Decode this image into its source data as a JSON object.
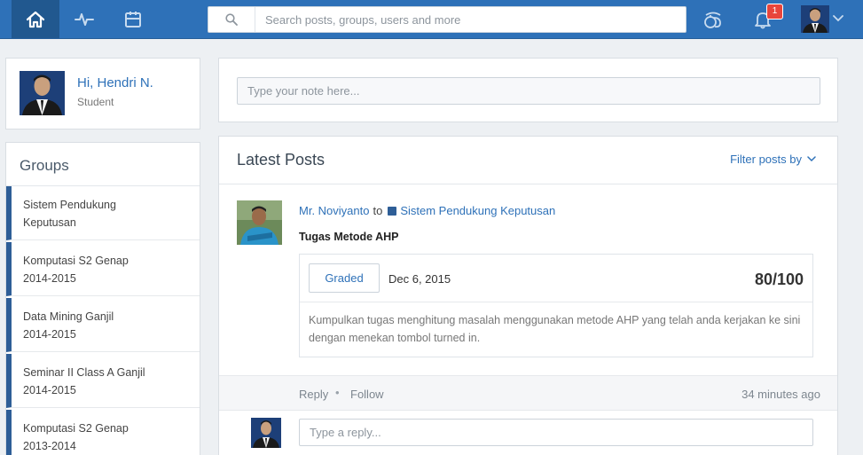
{
  "topbar": {
    "search_placeholder": "Search posts, groups, users and more",
    "notification_count": "1",
    "colors": {
      "bar": "#2e71b8",
      "active": "#21588f",
      "badge": "#e8453c"
    }
  },
  "profile": {
    "greeting": "Hi, Hendri N.",
    "role": "Student"
  },
  "groups": {
    "title": "Groups",
    "items": [
      {
        "name": "Sistem Pendukung",
        "subtitle": "Keputusan"
      },
      {
        "name": "Komputasi S2 Genap",
        "subtitle": "2014-2015"
      },
      {
        "name": "Data Mining Ganjil",
        "subtitle": "2014-2015"
      },
      {
        "name": "Seminar II Class A Ganjil",
        "subtitle": "2014-2015"
      },
      {
        "name": "Komputasi S2 Genap",
        "subtitle": "2013-2014"
      }
    ]
  },
  "note": {
    "placeholder": "Type your note here..."
  },
  "posts": {
    "title": "Latest Posts",
    "filter_label": "Filter posts by",
    "post": {
      "author": "Mr. Noviyanto",
      "to_word": "to",
      "group": "Sistem Pendukung Keputusan",
      "title": "Tugas Metode AHP",
      "assignment": {
        "status_label": "Graded",
        "date": "Dec 6, 2015",
        "score": "80/100",
        "description": "Kumpulkan tugas menghitung masalah menggunakan metode AHP yang telah anda kerjakan ke sini dengan menekan tombol turned in."
      },
      "actions": {
        "reply": "Reply",
        "separator": "•",
        "follow": "Follow",
        "time": "34 minutes ago"
      },
      "reply_placeholder": "Type a reply..."
    }
  },
  "icons": {
    "home": "home-icon",
    "activity": "activity-icon",
    "calendar": "calendar-icon",
    "search": "search-icon",
    "backpack": "backpack-icon",
    "bell": "bell-icon",
    "chevron": "chevron-down-icon"
  }
}
